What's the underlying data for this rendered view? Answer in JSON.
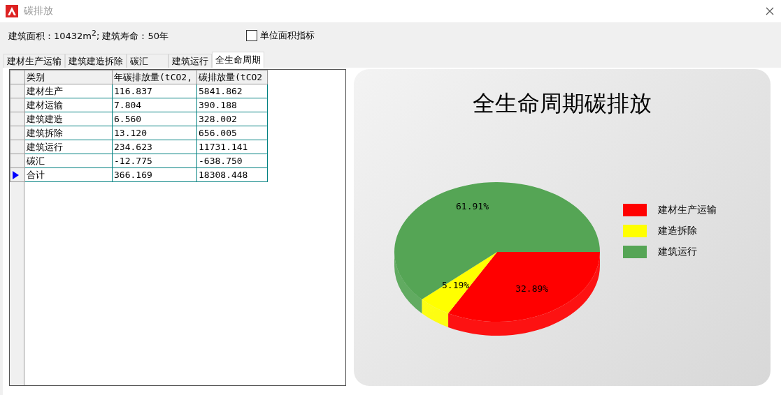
{
  "window": {
    "title": "碳排放"
  },
  "info": {
    "text": "建筑面积：10432m$^{2}$; 建筑寿命：50年"
  },
  "unit_checkbox": {
    "label": "单位面积指标",
    "checked": false
  },
  "tabs": [
    {
      "label": "建材生产运输",
      "selected": false
    },
    {
      "label": "建筑建造拆除",
      "selected": false
    },
    {
      "label": "碳汇",
      "selected": false
    },
    {
      "label": "建筑运行",
      "selected": false
    },
    {
      "label": "全生命周期",
      "selected": true
    }
  ],
  "table": {
    "columns": [
      "类别",
      "年碳排放量(tCO2,",
      "碳排放量(tCO2"
    ],
    "rows": [
      {
        "cells": [
          "建材生产",
          "116.837",
          "5841.862"
        ],
        "selected": false
      },
      {
        "cells": [
          "建材运输",
          "7.804",
          "390.188"
        ],
        "selected": false
      },
      {
        "cells": [
          "建筑建造",
          "6.560",
          "328.002"
        ],
        "selected": false
      },
      {
        "cells": [
          "建筑拆除",
          "13.120",
          "656.005"
        ],
        "selected": false
      },
      {
        "cells": [
          "建筑运行",
          "234.623",
          "11731.141"
        ],
        "selected": false
      },
      {
        "cells": [
          "碳汇",
          "-12.775",
          "-638.750"
        ],
        "selected": false
      },
      {
        "cells": [
          "合计",
          "366.169",
          "18308.448"
        ],
        "selected": true
      }
    ]
  },
  "chart": {
    "chart_data": {
      "type": "pie",
      "title": "全生命周期碳排放",
      "categories": [
        "建材生产运输",
        "建造拆除",
        "建筑运行"
      ],
      "series": [
        {
          "values": [
            32.89,
            5.19,
            61.91
          ],
          "colors": [
            "#ff0000",
            "#ffff00",
            "#55a555"
          ]
        }
      ],
      "value_labels": [
        "32.89%",
        "5.19%",
        "61.91%"
      ]
    }
  }
}
